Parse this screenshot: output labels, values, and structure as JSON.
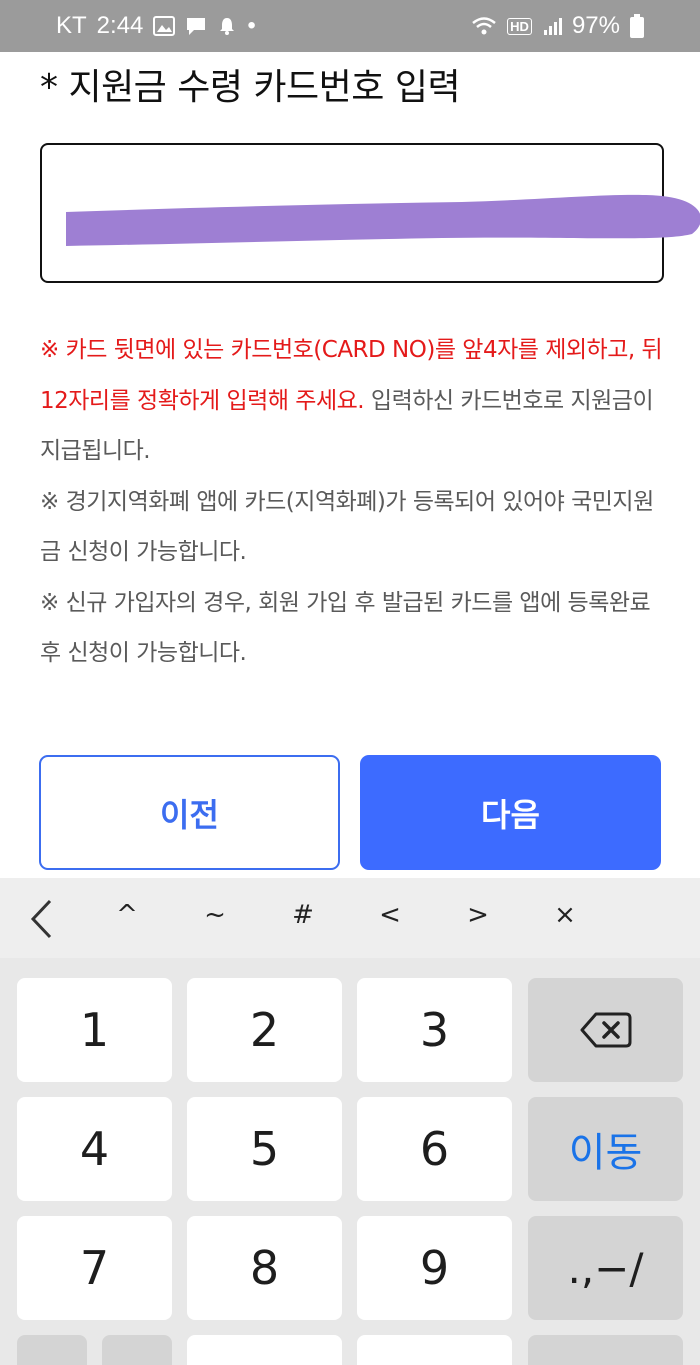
{
  "status_bar": {
    "carrier": "KT",
    "time": "2:44",
    "dot": "•",
    "hd_badge": "HD",
    "battery": "97%"
  },
  "form": {
    "title": "* 지원금 수령 카드번호 입력",
    "card_number_value": ""
  },
  "notice": {
    "line1_prefix": "※ ",
    "line1_highlight": "카드 뒷면에 있는 카드번호(CARD NO)를 앞4자를 제외하고, 뒤 12자리를 정확하게 입력해 주세요.",
    "line1_rest": " 입력하신 카드번호로 지원금이 지급됩니다.",
    "line2": "※ 경기지역화폐 앱에 카드(지역화폐)가 등록되어 있어야 국민지원금 신청이 가능합니다.",
    "line3": "※ 신규 가입자의 경우, 회원 가입 후 발급된 카드를 앱에 등록완료 후 신청이 가능합니다."
  },
  "buttons": {
    "prev": "이전",
    "next": "다음"
  },
  "keyboard": {
    "symbols": [
      "^",
      "~",
      "#",
      "<",
      ">",
      "×"
    ],
    "keys": {
      "k1": "1",
      "k2": "2",
      "k3": "3",
      "k4": "4",
      "k5": "5",
      "k6": "6",
      "k7": "7",
      "k8": "8",
      "k9": "9",
      "move": "이동",
      "punct": ".,−/"
    }
  },
  "colors": {
    "accent": "#3d6bff",
    "warning": "#e41a1a",
    "redaction": "#9e7fd3"
  }
}
